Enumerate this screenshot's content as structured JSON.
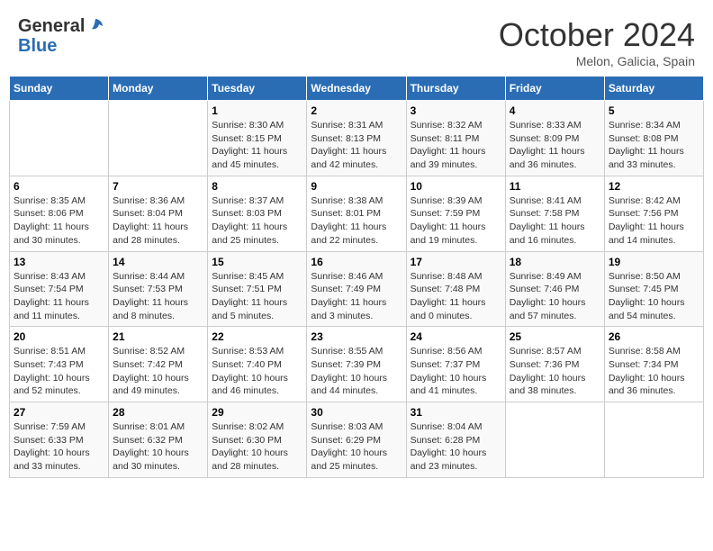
{
  "header": {
    "logo_general": "General",
    "logo_blue": "Blue",
    "month_title": "October 2024",
    "subtitle": "Melon, Galicia, Spain"
  },
  "days_of_week": [
    "Sunday",
    "Monday",
    "Tuesday",
    "Wednesday",
    "Thursday",
    "Friday",
    "Saturday"
  ],
  "weeks": [
    [
      {
        "day": "",
        "info": ""
      },
      {
        "day": "",
        "info": ""
      },
      {
        "day": "1",
        "info": "Sunrise: 8:30 AM\nSunset: 8:15 PM\nDaylight: 11 hours and 45 minutes."
      },
      {
        "day": "2",
        "info": "Sunrise: 8:31 AM\nSunset: 8:13 PM\nDaylight: 11 hours and 42 minutes."
      },
      {
        "day": "3",
        "info": "Sunrise: 8:32 AM\nSunset: 8:11 PM\nDaylight: 11 hours and 39 minutes."
      },
      {
        "day": "4",
        "info": "Sunrise: 8:33 AM\nSunset: 8:09 PM\nDaylight: 11 hours and 36 minutes."
      },
      {
        "day": "5",
        "info": "Sunrise: 8:34 AM\nSunset: 8:08 PM\nDaylight: 11 hours and 33 minutes."
      }
    ],
    [
      {
        "day": "6",
        "info": "Sunrise: 8:35 AM\nSunset: 8:06 PM\nDaylight: 11 hours and 30 minutes."
      },
      {
        "day": "7",
        "info": "Sunrise: 8:36 AM\nSunset: 8:04 PM\nDaylight: 11 hours and 28 minutes."
      },
      {
        "day": "8",
        "info": "Sunrise: 8:37 AM\nSunset: 8:03 PM\nDaylight: 11 hours and 25 minutes."
      },
      {
        "day": "9",
        "info": "Sunrise: 8:38 AM\nSunset: 8:01 PM\nDaylight: 11 hours and 22 minutes."
      },
      {
        "day": "10",
        "info": "Sunrise: 8:39 AM\nSunset: 7:59 PM\nDaylight: 11 hours and 19 minutes."
      },
      {
        "day": "11",
        "info": "Sunrise: 8:41 AM\nSunset: 7:58 PM\nDaylight: 11 hours and 16 minutes."
      },
      {
        "day": "12",
        "info": "Sunrise: 8:42 AM\nSunset: 7:56 PM\nDaylight: 11 hours and 14 minutes."
      }
    ],
    [
      {
        "day": "13",
        "info": "Sunrise: 8:43 AM\nSunset: 7:54 PM\nDaylight: 11 hours and 11 minutes."
      },
      {
        "day": "14",
        "info": "Sunrise: 8:44 AM\nSunset: 7:53 PM\nDaylight: 11 hours and 8 minutes."
      },
      {
        "day": "15",
        "info": "Sunrise: 8:45 AM\nSunset: 7:51 PM\nDaylight: 11 hours and 5 minutes."
      },
      {
        "day": "16",
        "info": "Sunrise: 8:46 AM\nSunset: 7:49 PM\nDaylight: 11 hours and 3 minutes."
      },
      {
        "day": "17",
        "info": "Sunrise: 8:48 AM\nSunset: 7:48 PM\nDaylight: 11 hours and 0 minutes."
      },
      {
        "day": "18",
        "info": "Sunrise: 8:49 AM\nSunset: 7:46 PM\nDaylight: 10 hours and 57 minutes."
      },
      {
        "day": "19",
        "info": "Sunrise: 8:50 AM\nSunset: 7:45 PM\nDaylight: 10 hours and 54 minutes."
      }
    ],
    [
      {
        "day": "20",
        "info": "Sunrise: 8:51 AM\nSunset: 7:43 PM\nDaylight: 10 hours and 52 minutes."
      },
      {
        "day": "21",
        "info": "Sunrise: 8:52 AM\nSunset: 7:42 PM\nDaylight: 10 hours and 49 minutes."
      },
      {
        "day": "22",
        "info": "Sunrise: 8:53 AM\nSunset: 7:40 PM\nDaylight: 10 hours and 46 minutes."
      },
      {
        "day": "23",
        "info": "Sunrise: 8:55 AM\nSunset: 7:39 PM\nDaylight: 10 hours and 44 minutes."
      },
      {
        "day": "24",
        "info": "Sunrise: 8:56 AM\nSunset: 7:37 PM\nDaylight: 10 hours and 41 minutes."
      },
      {
        "day": "25",
        "info": "Sunrise: 8:57 AM\nSunset: 7:36 PM\nDaylight: 10 hours and 38 minutes."
      },
      {
        "day": "26",
        "info": "Sunrise: 8:58 AM\nSunset: 7:34 PM\nDaylight: 10 hours and 36 minutes."
      }
    ],
    [
      {
        "day": "27",
        "info": "Sunrise: 7:59 AM\nSunset: 6:33 PM\nDaylight: 10 hours and 33 minutes."
      },
      {
        "day": "28",
        "info": "Sunrise: 8:01 AM\nSunset: 6:32 PM\nDaylight: 10 hours and 30 minutes."
      },
      {
        "day": "29",
        "info": "Sunrise: 8:02 AM\nSunset: 6:30 PM\nDaylight: 10 hours and 28 minutes."
      },
      {
        "day": "30",
        "info": "Sunrise: 8:03 AM\nSunset: 6:29 PM\nDaylight: 10 hours and 25 minutes."
      },
      {
        "day": "31",
        "info": "Sunrise: 8:04 AM\nSunset: 6:28 PM\nDaylight: 10 hours and 23 minutes."
      },
      {
        "day": "",
        "info": ""
      },
      {
        "day": "",
        "info": ""
      }
    ]
  ]
}
